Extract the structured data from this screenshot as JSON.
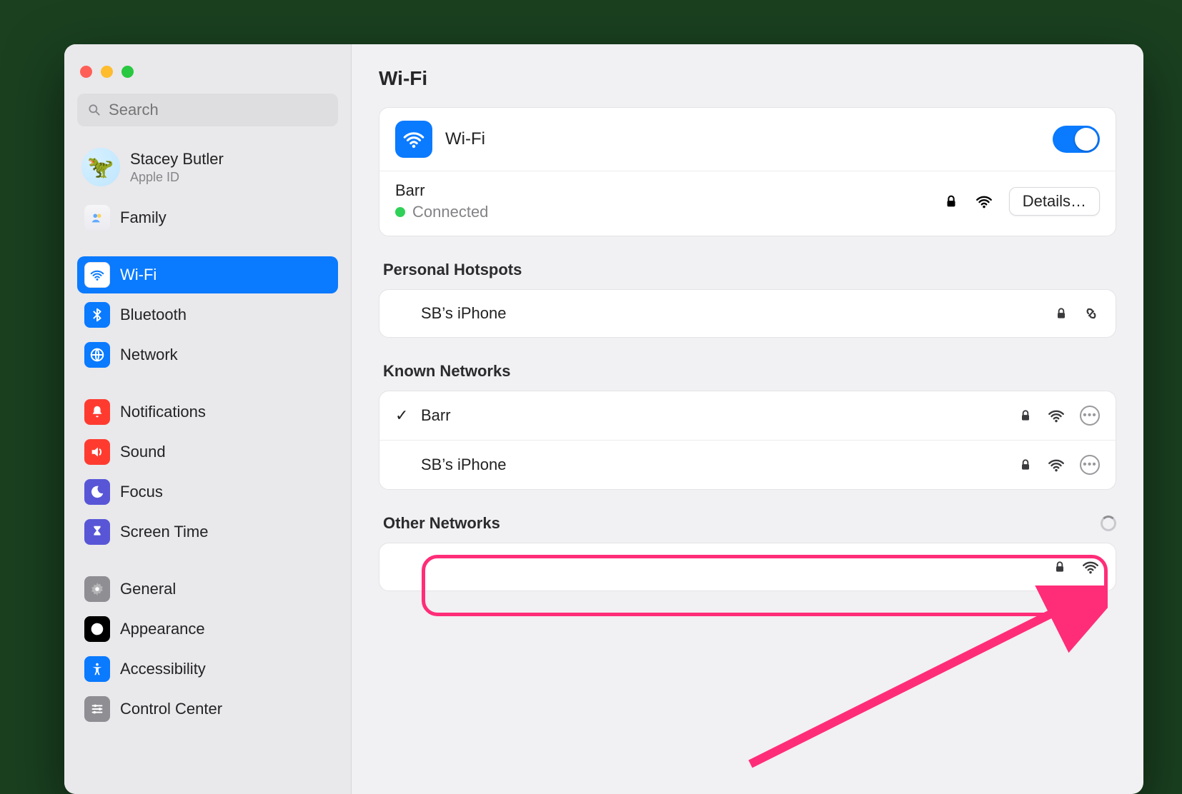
{
  "window_title": "Wi-Fi",
  "search": {
    "placeholder": "Search"
  },
  "account": {
    "name": "Stacey Butler",
    "subtitle": "Apple ID"
  },
  "sidebar": {
    "items": [
      {
        "label": "Family"
      },
      {
        "label": "Wi-Fi"
      },
      {
        "label": "Bluetooth"
      },
      {
        "label": "Network"
      },
      {
        "label": "Notifications"
      },
      {
        "label": "Sound"
      },
      {
        "label": "Focus"
      },
      {
        "label": "Screen Time"
      },
      {
        "label": "General"
      },
      {
        "label": "Appearance"
      },
      {
        "label": "Accessibility"
      },
      {
        "label": "Control Center"
      }
    ]
  },
  "wifi": {
    "toggle_label": "Wi-Fi",
    "toggle_on": true,
    "connected": {
      "ssid": "Barr",
      "status": "Connected",
      "secure": true
    },
    "details_button": "Details…",
    "sections": {
      "hotspots_title": "Personal Hotspots",
      "hotspots": [
        {
          "name": "SB’s iPhone",
          "secure": true,
          "link": true
        }
      ],
      "known_title": "Known Networks",
      "known": [
        {
          "name": "Barr",
          "checked": true,
          "secure": true
        },
        {
          "name": "SB’s iPhone",
          "checked": false,
          "secure": true
        }
      ],
      "other_title": "Other Networks",
      "other": [
        {
          "name": "",
          "secure": true
        }
      ]
    }
  }
}
